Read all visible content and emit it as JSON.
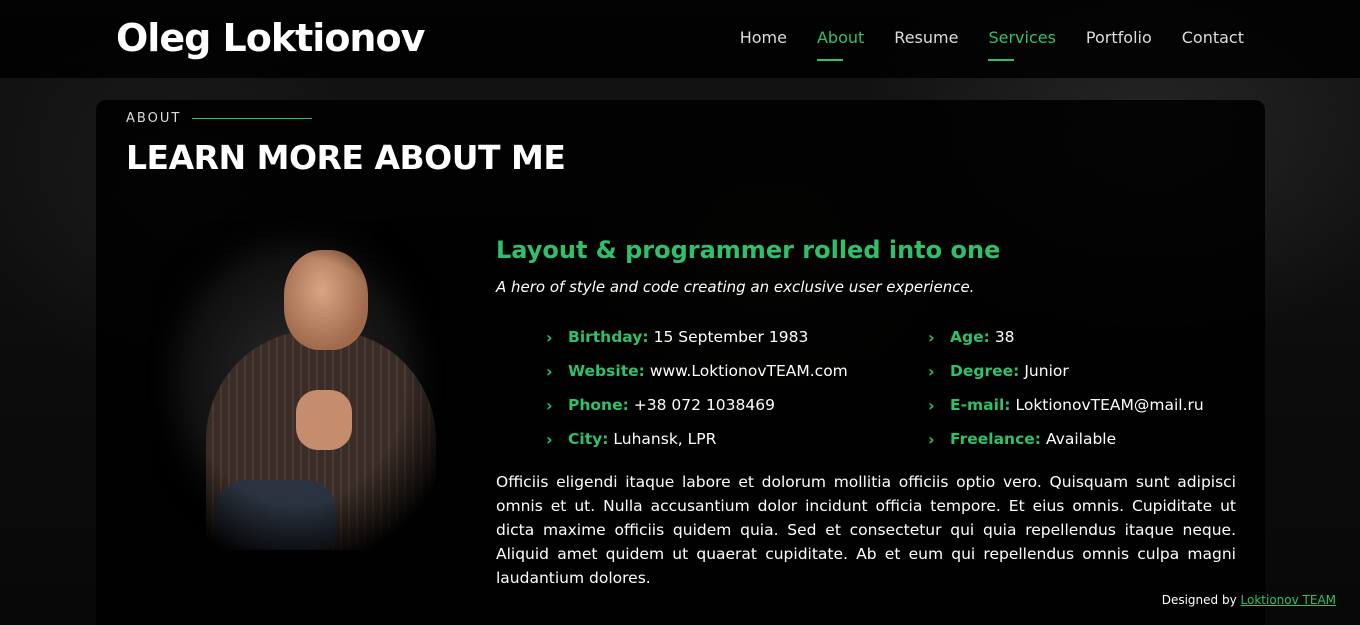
{
  "header": {
    "logo": "Oleg Loktionov",
    "nav": [
      {
        "label": "Home",
        "active": false
      },
      {
        "label": "About",
        "active": true
      },
      {
        "label": "Resume",
        "active": false
      },
      {
        "label": "Services",
        "active": true
      },
      {
        "label": "Portfolio",
        "active": false
      },
      {
        "label": "Contact",
        "active": false
      }
    ]
  },
  "about": {
    "section_label": "ABOUT",
    "title": "LEARN MORE ABOUT ME",
    "photo_icon": "profile-photo",
    "tagline": "Layout & programmer rolled into one",
    "subtitle": "A hero of style and code creating an exclusive user experience.",
    "facts_left": [
      {
        "label": "Birthday:",
        "value": "15 September 1983"
      },
      {
        "label": "Website:",
        "value": "www.LoktionovTEAM.com"
      },
      {
        "label": "Phone:",
        "value": "+38 072 1038469"
      },
      {
        "label": "City:",
        "value": "Luhansk, LPR"
      }
    ],
    "facts_right": [
      {
        "label": "Age:",
        "value": "38"
      },
      {
        "label": "Degree:",
        "value": "Junior"
      },
      {
        "label": "E-mail:",
        "value": "LoktionovTEAM@mail.ru"
      },
      {
        "label": "Freelance:",
        "value": "Available"
      }
    ],
    "bio": "Officiis eligendi itaque labore et dolorum mollitia officiis optio vero. Quisquam sunt adipisci omnis et ut. Nulla accusantium dolor incidunt officia tempore. Et eius omnis. Cupiditate ut dicta maxime officiis quidem quia. Sed et consectetur qui quia repellendus itaque neque. Aliquid amet quidem ut quaerat cupiditate. Ab et eum qui repellendus omnis culpa magni laudantium dolores."
  },
  "footer": {
    "credit_prefix": "Designed by",
    "credit_link": "Loktionov TEAM"
  },
  "colors": {
    "accent": "#2fc16a",
    "background": "#0b0b0b"
  }
}
